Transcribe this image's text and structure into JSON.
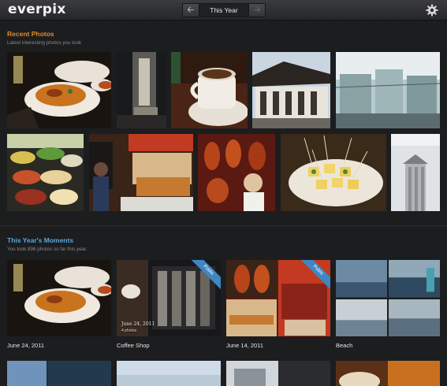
{
  "app": {
    "logo": "everpix"
  },
  "header": {
    "period_label": "This Year",
    "prev_icon": "arrow-left-icon",
    "next_icon": "arrow-right-icon",
    "settings_icon": "gear-icon"
  },
  "recent": {
    "title": "Recent Photos",
    "subtitle": "Latest interesting photos you took",
    "photos": [
      "food-dish-photo",
      "glass-interior-photo",
      "coffee-cup-photo",
      "temple-roof-photo",
      "glass-building-photo",
      "buffet-counter-photo",
      "food-stall-photo",
      "roast-duck-photo",
      "skewer-appetizer-photo",
      "tower-photo"
    ]
  },
  "moments": {
    "title": "This Year's Moments",
    "subtitle": "You took 896 photos so far this year.",
    "items": [
      {
        "caption": "June 24, 2011",
        "public": false,
        "overlay_date": "",
        "overlay_count": ""
      },
      {
        "caption": "Coffee Shop",
        "public": true,
        "overlay_date": "June 24, 2011",
        "overlay_count": "4 photos"
      },
      {
        "caption": "June 14, 2011",
        "public": true,
        "overlay_date": "",
        "overlay_count": ""
      },
      {
        "caption": "Beach",
        "public": false,
        "overlay_date": "",
        "overlay_count": ""
      }
    ],
    "public_badge": "Public"
  },
  "colors": {
    "background": "#1c1d1f",
    "recent_heading": "#e08a2a",
    "moments_heading": "#5ea6d8",
    "public_ribbon": "#3f86c2"
  }
}
